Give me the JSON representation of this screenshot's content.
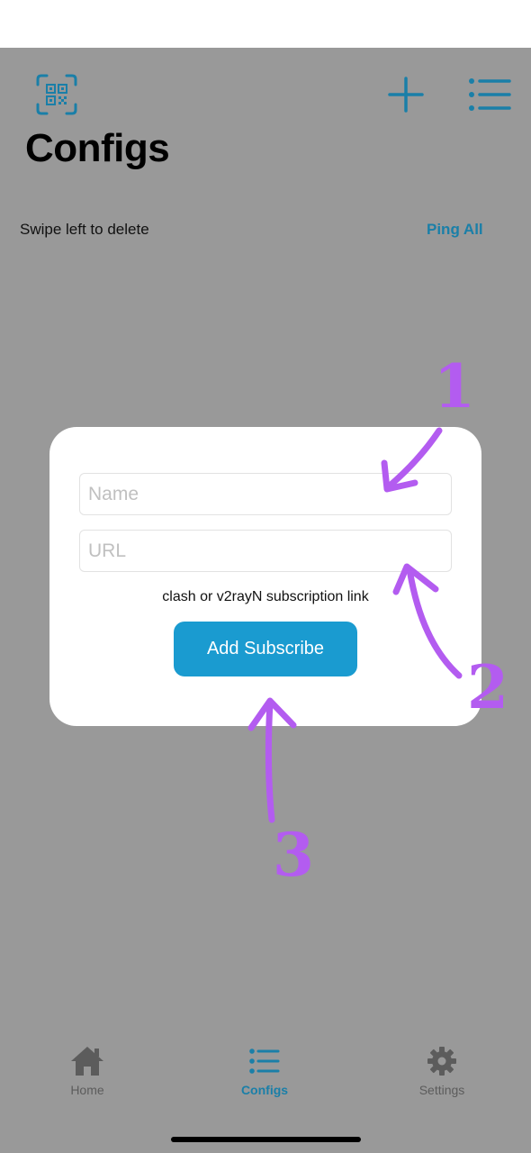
{
  "colors": {
    "accent": "#1a7fa8",
    "button": "#1a9bd0",
    "overlay": "#999999",
    "annotation": "#b35cf0"
  },
  "header": {
    "title": "Configs",
    "icons": [
      "qr-code-scan-icon",
      "plus-icon",
      "list-icon"
    ]
  },
  "toolbar": {
    "hint": "Swipe left to delete",
    "ping_all_label": "Ping All"
  },
  "dialog": {
    "name_placeholder": "Name",
    "url_placeholder": "URL",
    "name_value": "",
    "url_value": "",
    "caption": "clash or v2rayN subscription link",
    "add_label": "Add Subscribe"
  },
  "annotations": {
    "numbers": [
      "1",
      "2",
      "3"
    ]
  },
  "tab_bar": {
    "tabs": [
      {
        "label": "Home",
        "icon": "home-icon",
        "active": false
      },
      {
        "label": "Configs",
        "icon": "list-icon",
        "active": true
      },
      {
        "label": "Settings",
        "icon": "gear-icon",
        "active": false
      }
    ]
  }
}
